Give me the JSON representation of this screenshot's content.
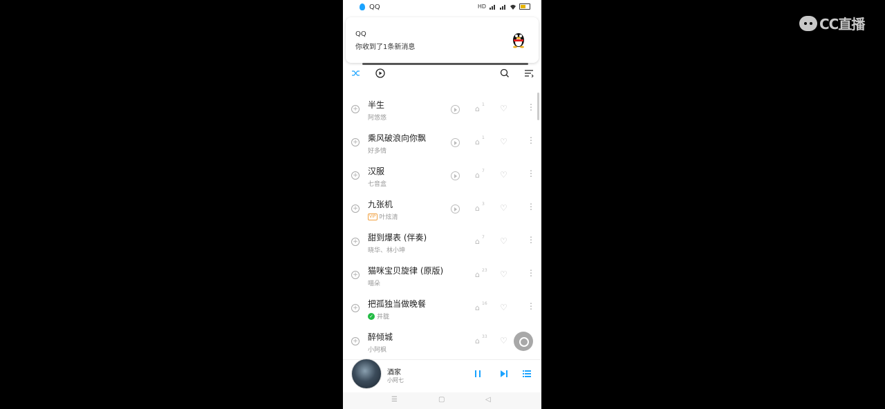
{
  "status_bar": {
    "app": "QQ",
    "indicators": "HD"
  },
  "notification": {
    "title": "QQ",
    "message": "你收到了1条新消息"
  },
  "songs": [
    {
      "title": "半生",
      "artist": "阿悠悠",
      "plays": "1",
      "has_mv": true,
      "badge": ""
    },
    {
      "title": "乘风破浪向你飘",
      "artist": "好多情",
      "plays": "1",
      "has_mv": true,
      "badge": ""
    },
    {
      "title": "汉服",
      "artist": "七音盒",
      "plays": "7",
      "has_mv": true,
      "badge": ""
    },
    {
      "title": "九张机",
      "artist": "叶炫清",
      "plays": "3",
      "has_mv": true,
      "badge": "VIP"
    },
    {
      "title": "甜到爆表 (伴奏)",
      "artist": "晓华、林小坤",
      "plays": "7",
      "has_mv": false,
      "badge": ""
    },
    {
      "title": "猫咪宝贝旋律 (原版)",
      "artist": "喵朵",
      "plays": "23",
      "has_mv": false,
      "badge": ""
    },
    {
      "title": "把孤独当做晚餐",
      "artist": "井胧",
      "plays": "16",
      "has_mv": false,
      "badge": "check"
    },
    {
      "title": "醉倾城",
      "artist": "小阿枫",
      "plays": "33",
      "has_mv": false,
      "badge": ""
    }
  ],
  "player": {
    "title": "酒家",
    "artist": "小阿七"
  },
  "watermark": "CC直播",
  "colors": {
    "accent": "#1aa3ff",
    "background": "#000000"
  }
}
